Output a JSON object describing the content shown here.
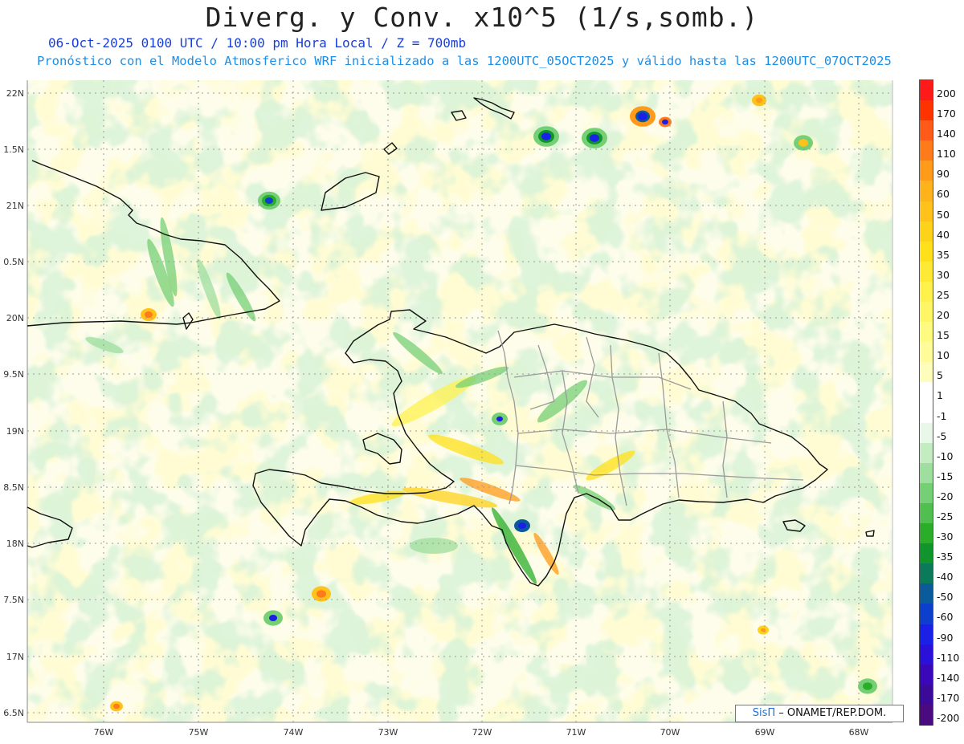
{
  "header": {
    "title": "Diverg. y Conv. x10^5 (1/s,somb.)",
    "line1": "06-Oct-2025  0100 UTC / 10:00 pm Hora Local / Z = 700mb",
    "line2": "Pronóstico con el Modelo Atmosferico WRF inicializado a las 1200UTC_05OCT2025 y válido hasta las  1200UTC_07OCT2025"
  },
  "axes": {
    "lat_labels": [
      "22N",
      "1.5N",
      "21N",
      "0.5N",
      "20N",
      "9.5N",
      "19N",
      "8.5N",
      "18N",
      "7.5N",
      "17N",
      "6.5N"
    ],
    "lon_labels": [
      "76W",
      "75W",
      "74W",
      "73W",
      "72W",
      "71W",
      "70W",
      "69W",
      "68W"
    ]
  },
  "colorbar": {
    "labels": [
      "200",
      "170",
      "140",
      "110",
      "90",
      "60",
      "50",
      "40",
      "35",
      "30",
      "25",
      "20",
      "15",
      "10",
      "5",
      "1",
      "-1",
      "-5",
      "-10",
      "-15",
      "-20",
      "-25",
      "-30",
      "-35",
      "-40",
      "-50",
      "-60",
      "-90",
      "-110",
      "-140",
      "-170",
      "-200"
    ],
    "colors": [
      "#ff1a1a",
      "#ff3300",
      "#ff5a1a",
      "#ff7a1a",
      "#ff9a1a",
      "#ffb31a",
      "#ffc21a",
      "#ffd21a",
      "#ffe01a",
      "#ffea33",
      "#fff24d",
      "#fff666",
      "#fffa80",
      "#fffc99",
      "#fffdbb",
      "#ffffff",
      "#ffffff",
      "#e8f7e8",
      "#c3ecc3",
      "#9ede9e",
      "#75cf75",
      "#4fc04f",
      "#2aae2a",
      "#10952d",
      "#0a7a5a",
      "#0b5a9a",
      "#0b3fcc",
      "#1a20e6",
      "#2a10d8",
      "#3a08b8",
      "#3c0a98",
      "#4a0a80"
    ]
  },
  "credit": {
    "sis": "SisΠ",
    "org": "– ONAMET/REP.DOM."
  }
}
